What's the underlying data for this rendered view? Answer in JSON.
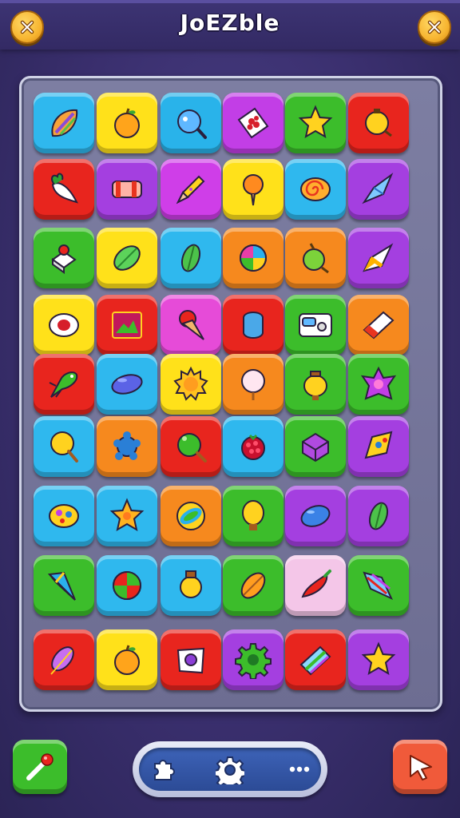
{
  "header": {
    "title": "JoEZble",
    "left_button_icon": "close-icon",
    "right_button_icon": "close-icon"
  },
  "board": {
    "rows": [
      [
        {
          "color": "#2fb8ee",
          "icon": "striped-leaf-icon"
        },
        {
          "color": "#ffe11a",
          "icon": "orange-fruit-icon"
        },
        {
          "color": "#29b3ea",
          "icon": "blue-fish-icon"
        },
        {
          "color": "#c23ee6",
          "icon": "red-dots-card-icon"
        },
        {
          "color": "#3cbd2b",
          "icon": "star-icon"
        },
        {
          "color": "#e8251e",
          "icon": "yellow-ball-icon"
        }
      ],
      [
        {
          "color": "#e8251e",
          "icon": "radish-icon"
        },
        {
          "color": "#a43fe0",
          "icon": "candy-bar-icon"
        },
        {
          "color": "#cf3ee8",
          "icon": "pencil-icon"
        },
        {
          "color": "#ffe11a",
          "icon": "ice-cream-icon"
        },
        {
          "color": "#2fb8ee",
          "icon": "swirl-icon"
        },
        {
          "color": "#a43fe0",
          "icon": "crystal-icon"
        }
      ],
      [
        {
          "color": "#3cbd2b",
          "icon": "cake-icon"
        },
        {
          "color": "#ffe11a",
          "icon": "leaf-icon"
        },
        {
          "color": "#2fb8ee",
          "icon": "green-leaf-icon"
        },
        {
          "color": "#f6891e",
          "icon": "beach-ball-icon"
        },
        {
          "color": "#f6891e",
          "icon": "green-apple-icon"
        },
        {
          "color": "#a43fe0",
          "icon": "rocket-icon"
        }
      ],
      [
        {
          "color": "#ffe11a",
          "icon": "egg-icon"
        },
        {
          "color": "#e8251e",
          "icon": "picture-icon"
        },
        {
          "color": "#e64bd8",
          "icon": "cone-icon"
        },
        {
          "color": "#e8251e",
          "icon": "blue-gem-icon"
        },
        {
          "color": "#3cbd2b",
          "icon": "machine-icon"
        },
        {
          "color": "#f6891e",
          "icon": "eraser-icon"
        }
      ],
      [
        {
          "color": "#e8251e",
          "icon": "lizard-icon"
        },
        {
          "color": "#2fb8ee",
          "icon": "blue-oval-icon"
        },
        {
          "color": "#ffe11a",
          "icon": "sun-icon"
        },
        {
          "color": "#f6891e",
          "icon": "pearl-icon"
        },
        {
          "color": "#3cbd2b",
          "icon": "lantern-icon"
        },
        {
          "color": "#3cbd2b",
          "icon": "purple-star-icon"
        }
      ],
      [
        {
          "color": "#2fb8ee",
          "icon": "yellow-lollipop-icon"
        },
        {
          "color": "#f6891e",
          "icon": "blue-flower-icon"
        },
        {
          "color": "#e8251e",
          "icon": "green-lollipop-icon"
        },
        {
          "color": "#2fb8ee",
          "icon": "raspberry-icon"
        },
        {
          "color": "#3cbd2b",
          "icon": "purple-cube-icon"
        },
        {
          "color": "#a43fe0",
          "icon": "badge-icon"
        }
      ],
      [
        {
          "color": "#2fb8ee",
          "icon": "spotted-egg-icon"
        },
        {
          "color": "#2fb8ee",
          "icon": "orange-star-icon"
        },
        {
          "color": "#f6891e",
          "icon": "marble-icon"
        },
        {
          "color": "#3cbd2b",
          "icon": "bulb-icon"
        },
        {
          "color": "#a43fe0",
          "icon": "blue-bean-icon"
        },
        {
          "color": "#a43fe0",
          "icon": "green-leaf-icon"
        }
      ],
      [
        {
          "color": "#3cbd2b",
          "icon": "rainbow-cone-icon"
        },
        {
          "color": "#2fb8ee",
          "icon": "ornament-icon"
        },
        {
          "color": "#2fb8ee",
          "icon": "yellow-bulb-icon"
        },
        {
          "color": "#3cbd2b",
          "icon": "orange-leaf-icon"
        },
        {
          "color": "#f4c6e8",
          "icon": "chili-pepper-icon"
        },
        {
          "color": "#3cbd2b",
          "icon": "rainbow-crystal-icon"
        }
      ],
      [
        {
          "color": "#e8251e",
          "icon": "purple-leaf-icon"
        },
        {
          "color": "#ffe11a",
          "icon": "orange-fruit-icon"
        },
        {
          "color": "#e8251e",
          "icon": "envelope-icon"
        },
        {
          "color": "#a43fe0",
          "icon": "green-gear-icon"
        },
        {
          "color": "#e8251e",
          "icon": "rainbow-bar-icon"
        },
        {
          "color": "#a43fe0",
          "icon": "star-icon"
        }
      ]
    ]
  },
  "bottom": {
    "left_button_color": "#3cbd2b",
    "left_button_icon": "magic-wand-icon",
    "right_button_color": "#f05a3a",
    "right_button_icon": "arrow-cursor-icon",
    "pill_icons": [
      "puzzle-icon",
      "gear-icon",
      "more-dots-icon"
    ]
  }
}
